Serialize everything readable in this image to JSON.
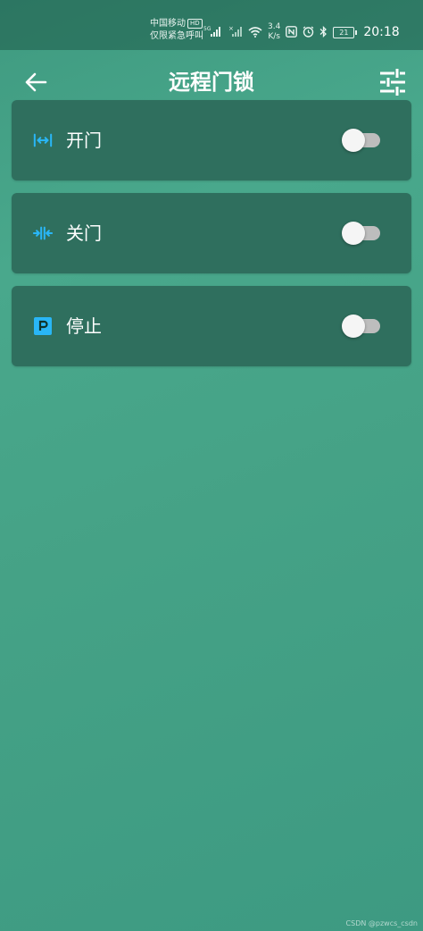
{
  "status_bar": {
    "carrier_line1": "中国移动",
    "carrier_badge": "HD",
    "carrier_line2": "仅限紧急呼叫",
    "network": "5G",
    "speed_value": "3.4",
    "speed_unit": "K/s",
    "battery": "21",
    "time": "20:18"
  },
  "app_bar": {
    "title": "远程门锁",
    "back_icon": "arrow-left-icon",
    "settings_icon": "sliders-icon"
  },
  "controls": [
    {
      "label": "开门",
      "icon": "expand-horizontal-icon",
      "enabled": false
    },
    {
      "label": "关门",
      "icon": "collapse-horizontal-icon",
      "enabled": false
    },
    {
      "label": "停止",
      "icon": "parking-p-icon",
      "enabled": false
    }
  ],
  "colors": {
    "accent_icon": "#29b6f6",
    "card_bg": "#2f6f5e",
    "page_bg": "#45a286"
  },
  "watermark": "CSDN @pzwcs_csdn"
}
